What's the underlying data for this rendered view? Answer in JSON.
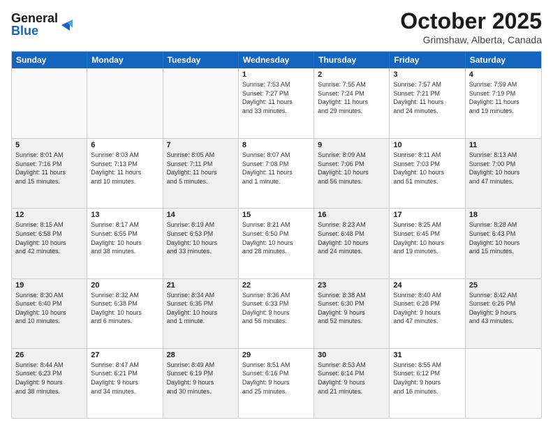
{
  "header": {
    "logo_line1": "General",
    "logo_line2": "Blue",
    "month_title": "October 2025",
    "location": "Grimshaw, Alberta, Canada"
  },
  "weekdays": [
    "Sunday",
    "Monday",
    "Tuesday",
    "Wednesday",
    "Thursday",
    "Friday",
    "Saturday"
  ],
  "rows": [
    [
      {
        "day": "",
        "text": "",
        "empty": true
      },
      {
        "day": "",
        "text": "",
        "empty": true
      },
      {
        "day": "",
        "text": "",
        "empty": true
      },
      {
        "day": "1",
        "text": "Sunrise: 7:53 AM\nSunset: 7:27 PM\nDaylight: 11 hours\nand 33 minutes."
      },
      {
        "day": "2",
        "text": "Sunrise: 7:55 AM\nSunset: 7:24 PM\nDaylight: 11 hours\nand 29 minutes."
      },
      {
        "day": "3",
        "text": "Sunrise: 7:57 AM\nSunset: 7:21 PM\nDaylight: 11 hours\nand 24 minutes."
      },
      {
        "day": "4",
        "text": "Sunrise: 7:59 AM\nSunset: 7:19 PM\nDaylight: 11 hours\nand 19 minutes."
      }
    ],
    [
      {
        "day": "5",
        "text": "Sunrise: 8:01 AM\nSunset: 7:16 PM\nDaylight: 11 hours\nand 15 minutes.",
        "shaded": true
      },
      {
        "day": "6",
        "text": "Sunrise: 8:03 AM\nSunset: 7:13 PM\nDaylight: 11 hours\nand 10 minutes."
      },
      {
        "day": "7",
        "text": "Sunrise: 8:05 AM\nSunset: 7:11 PM\nDaylight: 11 hours\nand 5 minutes.",
        "shaded": true
      },
      {
        "day": "8",
        "text": "Sunrise: 8:07 AM\nSunset: 7:08 PM\nDaylight: 11 hours\nand 1 minute."
      },
      {
        "day": "9",
        "text": "Sunrise: 8:09 AM\nSunset: 7:06 PM\nDaylight: 10 hours\nand 56 minutes.",
        "shaded": true
      },
      {
        "day": "10",
        "text": "Sunrise: 8:11 AM\nSunset: 7:03 PM\nDaylight: 10 hours\nand 51 minutes."
      },
      {
        "day": "11",
        "text": "Sunrise: 8:13 AM\nSunset: 7:00 PM\nDaylight: 10 hours\nand 47 minutes.",
        "shaded": true
      }
    ],
    [
      {
        "day": "12",
        "text": "Sunrise: 8:15 AM\nSunset: 6:58 PM\nDaylight: 10 hours\nand 42 minutes.",
        "shaded": true
      },
      {
        "day": "13",
        "text": "Sunrise: 8:17 AM\nSunset: 6:55 PM\nDaylight: 10 hours\nand 38 minutes."
      },
      {
        "day": "14",
        "text": "Sunrise: 8:19 AM\nSunset: 6:53 PM\nDaylight: 10 hours\nand 33 minutes.",
        "shaded": true
      },
      {
        "day": "15",
        "text": "Sunrise: 8:21 AM\nSunset: 6:50 PM\nDaylight: 10 hours\nand 28 minutes."
      },
      {
        "day": "16",
        "text": "Sunrise: 8:23 AM\nSunset: 6:48 PM\nDaylight: 10 hours\nand 24 minutes.",
        "shaded": true
      },
      {
        "day": "17",
        "text": "Sunrise: 8:25 AM\nSunset: 6:45 PM\nDaylight: 10 hours\nand 19 minutes."
      },
      {
        "day": "18",
        "text": "Sunrise: 8:28 AM\nSunset: 6:43 PM\nDaylight: 10 hours\nand 15 minutes.",
        "shaded": true
      }
    ],
    [
      {
        "day": "19",
        "text": "Sunrise: 8:30 AM\nSunset: 6:40 PM\nDaylight: 10 hours\nand 10 minutes.",
        "shaded": true
      },
      {
        "day": "20",
        "text": "Sunrise: 8:32 AM\nSunset: 6:38 PM\nDaylight: 10 hours\nand 6 minutes."
      },
      {
        "day": "21",
        "text": "Sunrise: 8:34 AM\nSunset: 6:35 PM\nDaylight: 10 hours\nand 1 minute.",
        "shaded": true
      },
      {
        "day": "22",
        "text": "Sunrise: 8:36 AM\nSunset: 6:33 PM\nDaylight: 9 hours\nand 56 minutes."
      },
      {
        "day": "23",
        "text": "Sunrise: 8:38 AM\nSunset: 6:30 PM\nDaylight: 9 hours\nand 52 minutes.",
        "shaded": true
      },
      {
        "day": "24",
        "text": "Sunrise: 8:40 AM\nSunset: 6:28 PM\nDaylight: 9 hours\nand 47 minutes."
      },
      {
        "day": "25",
        "text": "Sunrise: 8:42 AM\nSunset: 6:26 PM\nDaylight: 9 hours\nand 43 minutes.",
        "shaded": true
      }
    ],
    [
      {
        "day": "26",
        "text": "Sunrise: 8:44 AM\nSunset: 6:23 PM\nDaylight: 9 hours\nand 38 minutes.",
        "shaded": true
      },
      {
        "day": "27",
        "text": "Sunrise: 8:47 AM\nSunset: 6:21 PM\nDaylight: 9 hours\nand 34 minutes."
      },
      {
        "day": "28",
        "text": "Sunrise: 8:49 AM\nSunset: 6:19 PM\nDaylight: 9 hours\nand 30 minutes.",
        "shaded": true
      },
      {
        "day": "29",
        "text": "Sunrise: 8:51 AM\nSunset: 6:16 PM\nDaylight: 9 hours\nand 25 minutes."
      },
      {
        "day": "30",
        "text": "Sunrise: 8:53 AM\nSunset: 6:14 PM\nDaylight: 9 hours\nand 21 minutes.",
        "shaded": true
      },
      {
        "day": "31",
        "text": "Sunrise: 8:55 AM\nSunset: 6:12 PM\nDaylight: 9 hours\nand 16 minutes."
      },
      {
        "day": "",
        "text": "",
        "empty": true
      }
    ]
  ]
}
